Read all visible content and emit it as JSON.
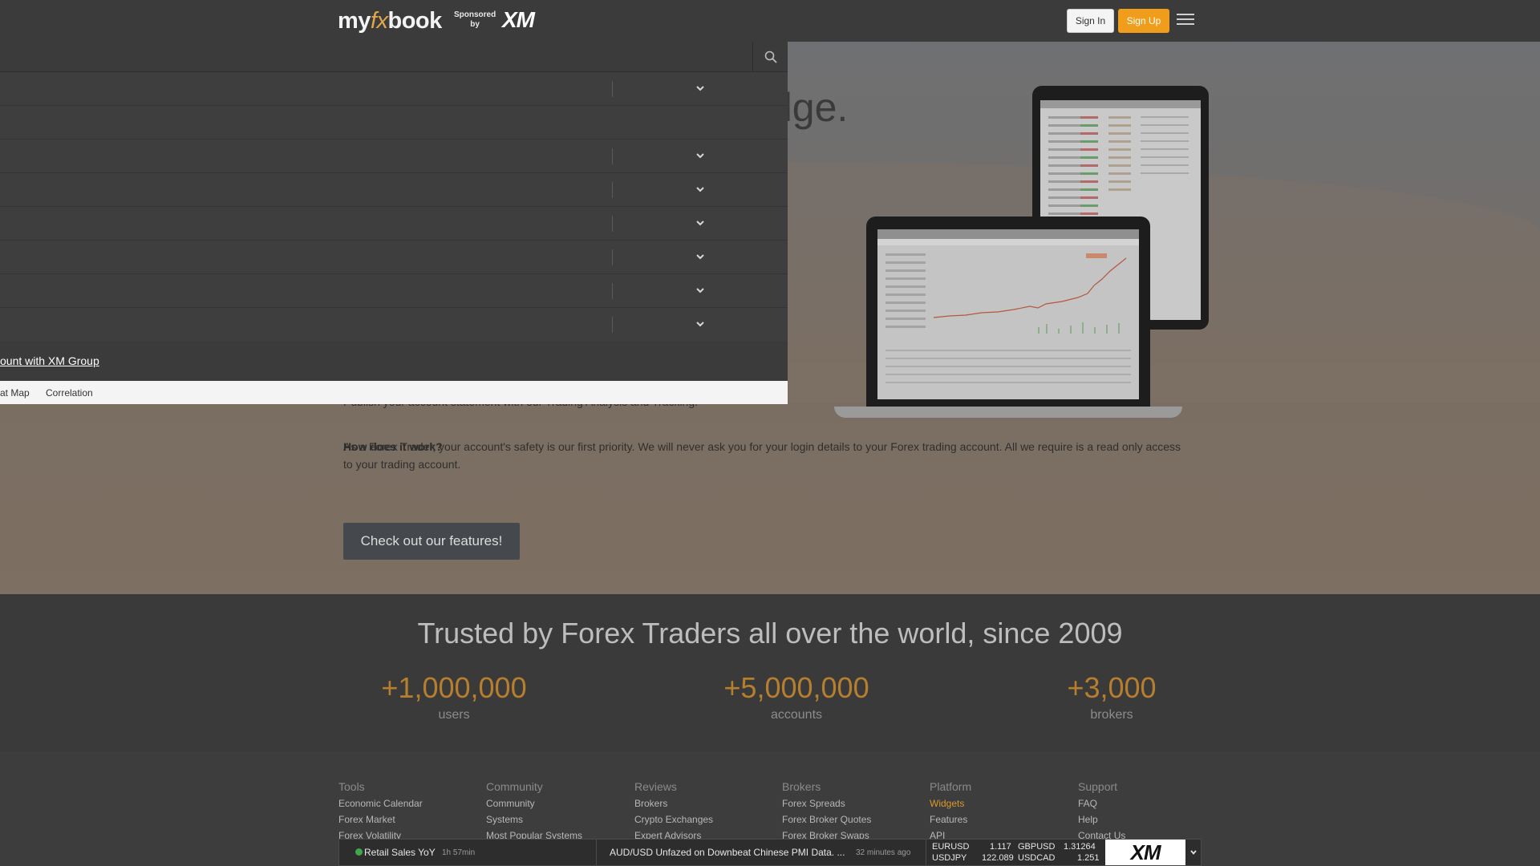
{
  "header": {
    "logo_my": "my",
    "logo_fx": "fx",
    "logo_book": "book",
    "sponsored_line1": "Sponsored",
    "sponsored_line2": "by",
    "sponsor_brand": "XM",
    "signin_label": "Sign In",
    "signup_label": "Sign Up"
  },
  "hero": {
    "headline_fragment": "dge.",
    "partial_line": "Publish your account statement with our Trading Analysis and Tracking.",
    "question": "How does it work?",
    "answer": "As a Forex Trader, your account's safety is our first priority. We will never ask you for your login details to your Forex trading account. All we require is a read only access to your trading account.",
    "features_button": "Check out our features!"
  },
  "menu": {
    "promo_link": "ount with XM Group",
    "tabs": [
      "at Map",
      "Correlation"
    ]
  },
  "trusted": {
    "title": "Trusted by Forex Traders all over the world, since 2009",
    "stats": [
      {
        "value": "+1,000,000",
        "label": "users"
      },
      {
        "value": "+5,000,000",
        "label": "accounts"
      },
      {
        "value": "+3,000",
        "label": "brokers"
      }
    ]
  },
  "footer": {
    "columns": [
      {
        "title": "Tools",
        "items": [
          "Economic Calendar",
          "Forex Market",
          "Forex Volatility"
        ]
      },
      {
        "title": "Community",
        "items": [
          "Community",
          "Systems",
          "Most Popular Systems"
        ]
      },
      {
        "title": "Reviews",
        "items": [
          "Brokers",
          "Crypto Exchanges",
          "Expert Advisors"
        ]
      },
      {
        "title": "Brokers",
        "items": [
          "Forex Spreads",
          "Forex Broker Quotes",
          "Forex Broker Swaps"
        ]
      },
      {
        "title": "Platform",
        "items": [
          "Widgets",
          "Features",
          "API"
        ]
      },
      {
        "title": "Support",
        "items": [
          "FAQ",
          "Help",
          "Contact Us"
        ]
      }
    ]
  },
  "ticker": {
    "news1_label": "Retail Sales YoY",
    "news1_time": "1h 57min",
    "news2_headline": "AUD/USD Unfazed on Downbeat Chinese PMI Data. ...",
    "news2_time": "32 minutes ago",
    "quotes": [
      {
        "symbol": "EURUSD",
        "price": "1.117"
      },
      {
        "symbol": "GBPUSD",
        "price": "1.31264"
      },
      {
        "symbol": "USDJPY",
        "price": "122.089"
      },
      {
        "symbol": "USDCAD",
        "price": "1.251"
      }
    ],
    "brand": "XM"
  },
  "colors": {
    "accent_orange": "#ef9d1a",
    "stat_gold": "#b67f2e",
    "live_green": "#3ea84a"
  }
}
